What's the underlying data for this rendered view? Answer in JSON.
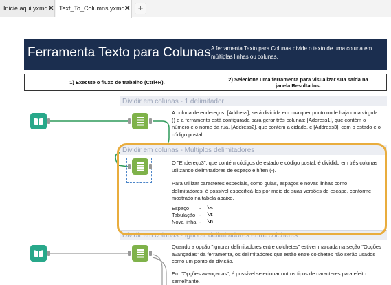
{
  "tabs": [
    {
      "label": "Inicie aqui.yxmd",
      "close": "✕"
    },
    {
      "label": "Text_To_Columns.yxmd",
      "close": "✕"
    }
  ],
  "add_tab": "+",
  "banner": {
    "title": "Ferramenta Texto para Colunas",
    "description": "A ferramenta Texto para Colunas divide o texto de uma coluna em múltiplas linhas ou colunas."
  },
  "steps": [
    "1) Execute o fluxo de trabalho (Ctrl+R).",
    "2) Selecione uma ferramenta para visualizar sua saída na janela Resultados."
  ],
  "containers": [
    {
      "title": "Dividir em colunas - 1 delimitador",
      "paragraphs": [
        "A coluna de endereços, [Address], será dividida em qualquer ponto onde haja uma vírgula () e a ferramenta está configurada para gerar três colunas: [Address1], que contém o número e o nome da rua, [Address2], que contém a cidade, e [Address3], com o estado e o código postal."
      ]
    },
    {
      "title": "Dividir em colunas - Múltiplos delimitadores",
      "paragraphs": [
        "O \"Endereço3\", que contém códigos de estado e código postal, é dividido em três colunas utilizando delimitadores de espaço e hífen (-).",
        "Para utilizar caracteres especiais, como guias, espaços e novas linhas como delimitadores, é possível especificá-los por meio de suas versões de escape, conforme mostrado na tabela abaixo."
      ],
      "escapes": [
        {
          "name": "Espaço",
          "dash": "-",
          "code": "\\s"
        },
        {
          "name": "Tabulação",
          "dash": "-",
          "code": "\\t"
        },
        {
          "name": "Nova linha",
          "dash": "-",
          "code": "\\n"
        }
      ]
    },
    {
      "title": "Dividir em colunas - Ignorar delimitadores entre colchetes",
      "paragraphs": [
        "Quando a opção \"Ignorar delimitadores entre colchetes\" estiver marcada na seção \"Opções avançadas\" da ferramenta, os delimitadores que estão entre colchetes não serão usados como um ponto de divisão.",
        "Em \"Opções avançadas\", é possível selecionar outros tipos de caracteres para efeito semelhante."
      ]
    }
  ],
  "colors": {
    "banner": "#1b2e4f",
    "input_tool": "#28a88a",
    "parse_tool": "#7fb24a",
    "connection": "#2e9a5a",
    "highlight": "#e9ad3e",
    "selection": "#4a84c8"
  }
}
